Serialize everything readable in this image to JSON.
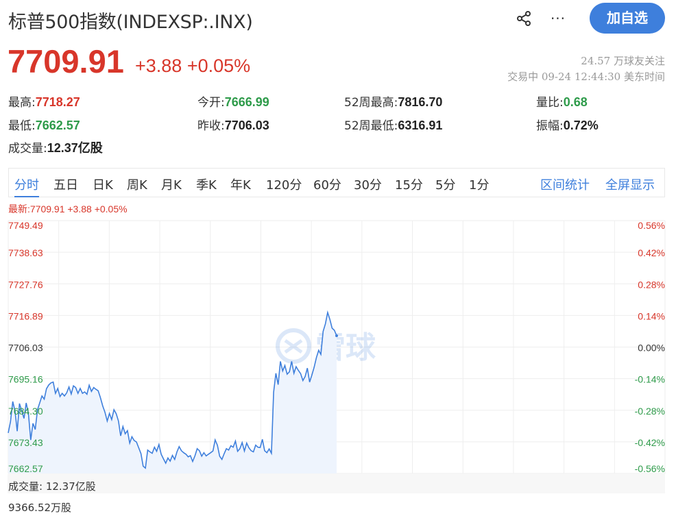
{
  "header": {
    "title": "标普500指数(INDEXSP:.INX)",
    "follow_label": "加自选",
    "more_label": "···"
  },
  "quote": {
    "price": "7709.91",
    "change": "+3.88 +0.05%",
    "followers": "24.57 万球友关注",
    "status_time": "交易中 09-24 12:44:30 美东时间"
  },
  "stats": {
    "high_label": "最高:",
    "high": "7718.27",
    "open_label": "今开:",
    "open": "7666.99",
    "w52_high_label": "52周最高:",
    "w52_high": "7816.70",
    "vol_ratio_label": "量比:",
    "vol_ratio": "0.68",
    "low_label": "最低:",
    "low": "7662.57",
    "prev_close_label": "昨收:",
    "prev_close": "7706.03",
    "w52_low_label": "52周最低:",
    "w52_low": "6316.91",
    "amplitude_label": "振幅:",
    "amplitude": "0.72%",
    "volume_label": "成交量:",
    "volume": "12.37亿股"
  },
  "tabs": [
    {
      "label": "分时"
    },
    {
      "label": "五日"
    },
    {
      "label": "日K"
    },
    {
      "label": "周K"
    },
    {
      "label": "月K"
    },
    {
      "label": "季K"
    },
    {
      "label": "年K"
    },
    {
      "label": "120分"
    },
    {
      "label": "60分"
    },
    {
      "label": "30分"
    },
    {
      "label": "15分"
    },
    {
      "label": "5分"
    },
    {
      "label": "1分"
    }
  ],
  "tab_links": {
    "range_stats": "区间统计",
    "fullscreen": "全屏显示"
  },
  "chart_info": {
    "latest": "最新:7709.91 +3.88 +0.05%",
    "watermark": "雪球",
    "volume_label": "成交量: 12.37亿股",
    "volume_amount": "9366.52万股"
  },
  "colors": {
    "up": "#d8362a",
    "down": "#2e9b4a",
    "line": "#3e7fdc",
    "fill": "#eef4fd",
    "accent": "#3e7fdc"
  },
  "chart_data": {
    "type": "line",
    "title": "",
    "xlabel": "",
    "ylabel": "",
    "ylim": [
      7662.57,
      7749.49
    ],
    "prev_close": 7706.03,
    "y_ticks": [
      "7749.49",
      "7738.63",
      "7727.76",
      "7716.89",
      "7706.03",
      "7695.16",
      "7684.30",
      "7673.43",
      "7662.57"
    ],
    "pct_ticks": [
      "0.56%",
      "0.42%",
      "0.28%",
      "0.14%",
      "0.00%",
      "-0.14%",
      "-0.28%",
      "-0.42%",
      "-0.56%"
    ],
    "x_sessions": 390,
    "x_last_index": 195,
    "grid": true,
    "series": [
      {
        "values": [
          7676.5,
          7680.4,
          7687.3,
          7684.2,
          7677.1,
          7686.6,
          7684.1,
          7681.5,
          7686.8,
          7683.1,
          7674.1,
          7679.8,
          7677.7,
          7684.5,
          7686.8,
          7689.2,
          7688.1,
          7691.7,
          7693.0,
          7693.7,
          7694.0,
          7690.1,
          7691.8,
          7689.0,
          7690.1,
          7689.2,
          7690.3,
          7692.3,
          7689.9,
          7692.7,
          7692.1,
          7690.1,
          7691.8,
          7690.1,
          7690.6,
          7689.8,
          7692.9,
          7690.8,
          7692.1,
          7691.5,
          7691.0,
          7688.6,
          7685.8,
          7683.6,
          7680.6,
          7683.2,
          7681.1,
          7684.5,
          7683.1,
          7680.6,
          7675.5,
          7678.7,
          7676.2,
          7677.3,
          7673.0,
          7675.2,
          7673.9,
          7673.4,
          7671.4,
          7669.4,
          7665.1,
          7664.4,
          7670.6,
          7670.0,
          7669.5,
          7671.6,
          7670.2,
          7672.5,
          7669.2,
          7667.6,
          7666.1,
          7667.9,
          7666.8,
          7668.8,
          7667.4,
          7670.0,
          7671.8,
          7670.4,
          7669.7,
          7669.2,
          7668.3,
          7668.7,
          7666.7,
          7668.6,
          7671.1,
          7670.4,
          7668.5,
          7669.7,
          7668.6,
          7669.2,
          7669.7,
          7670.3,
          7674.1,
          7672.3,
          7668.5,
          7667.4,
          7669.4,
          7671.1,
          7670.6,
          7672.1,
          7671.6,
          7673.7,
          7670.2,
          7671.1,
          7673.2,
          7670.3,
          7673.0,
          7671.4,
          7670.4,
          7670.0,
          7672.3,
          7671.6,
          7671.5,
          7674.3,
          7670.4,
          7669.7,
          7671.0,
          7669.5,
          7690.5,
          7697.0,
          7693.1,
          7701.1,
          7697.8,
          7699.7,
          7696.7,
          7697.5,
          7701.1,
          7697.0,
          7699.3,
          7698.0,
          7696.9,
          7694.5,
          7695.9,
          7698.8,
          7694.0,
          7696.4,
          7699.1,
          7702.4,
          7704.9,
          7703.5,
          7711.4,
          7714.0,
          7717.9,
          7715.5,
          7712.5,
          7711.8,
          7709.91
        ]
      }
    ]
  }
}
